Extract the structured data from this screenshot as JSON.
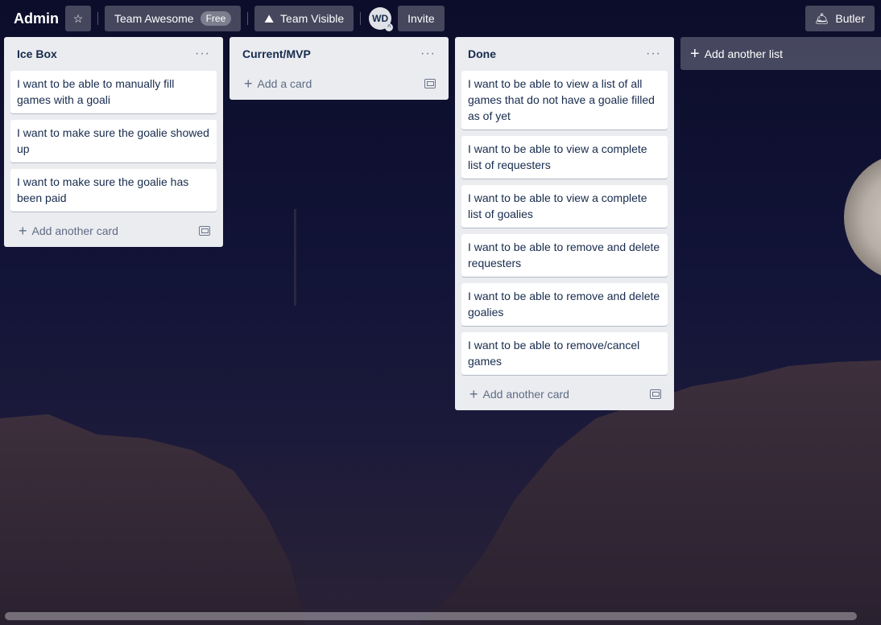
{
  "header": {
    "board_title": "Admin",
    "team_name": "Team Awesome",
    "team_badge": "Free",
    "visibility": "Team Visible",
    "member_initials": "WD",
    "invite_label": "Invite",
    "butler_label": "Butler"
  },
  "lists": [
    {
      "title": "Ice Box",
      "cards": [
        "I want to be able to manually fill games with a goali",
        "I want to make sure the goalie showed up",
        "I want to make sure the goalie has been paid"
      ],
      "composer": "Add another card"
    },
    {
      "title": "Current/MVP",
      "cards": [],
      "composer": "Add a card"
    },
    {
      "title": "Done",
      "cards": [
        "I want to be able to view a list of all games that do not have a goalie filled as of yet",
        "I want to be able to view a complete list of requesters",
        "I want to be able to view a complete list of goalies",
        "I want to be able to remove and delete requesters",
        "I want to be able to remove and delete goalies",
        "I want to be able to remove/cancel games"
      ],
      "composer": "Add another card"
    }
  ],
  "add_list_label": "Add another list",
  "icons": {
    "star": "star-icon",
    "visibility": "team-icon",
    "butler": "butler-bell-icon",
    "list_menu": "ellipsis-icon",
    "template": "card-template-icon",
    "plus": "plus-icon"
  }
}
